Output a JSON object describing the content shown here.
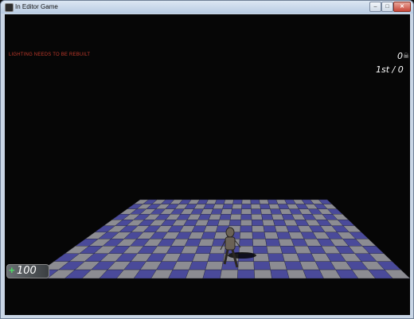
{
  "window": {
    "title": "In Editor Game"
  },
  "hud": {
    "lighting_warning": "LIGHTING NEEDS TO BE REBUILT",
    "score": "0",
    "rank": "1st / 0",
    "health": "100",
    "health_icon": "plus-icon",
    "score_icon": "skull-icon"
  },
  "colors": {
    "tile_blue": "#4a4a9a",
    "tile_gray": "#8c8c92",
    "warning": "#c0392b",
    "health_plus": "#4cd964"
  }
}
